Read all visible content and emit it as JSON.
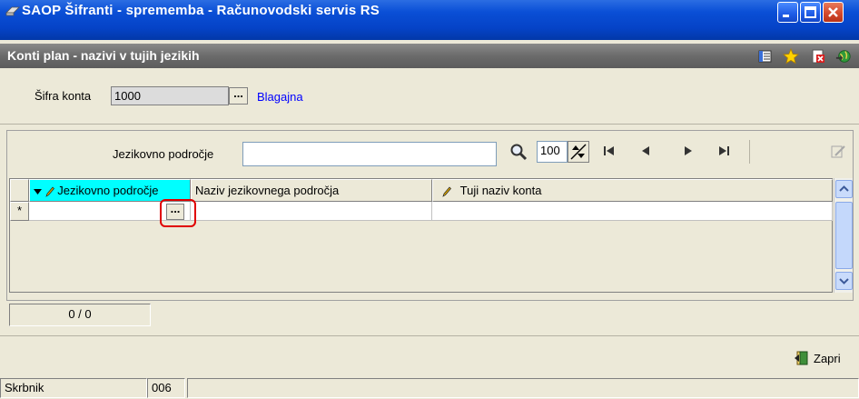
{
  "window": {
    "title": "SAOP  Šifranti - sprememba - Računovodski servis RS",
    "controls": [
      "minimize-icon",
      "maximize-icon",
      "close-icon"
    ]
  },
  "subheader": {
    "title": "Konti plan - nazivi v tujih jezikih",
    "tools": [
      "list-icon",
      "star-icon",
      "delete-icon",
      "globe-icon"
    ]
  },
  "account": {
    "label": "Šifra konta",
    "value": "1000",
    "lookup_label": "...",
    "name": "Blagajna"
  },
  "filter": {
    "label": "Jezikovno področje",
    "value": "",
    "page_size": "100"
  },
  "grid": {
    "columns": [
      "Jezikovno področje",
      "Naziv jezikovnega področja",
      "Tuji naziv konta"
    ],
    "new_row_marker": "*",
    "lookup_label": "..."
  },
  "record_counter": "0 / 0",
  "close_button": {
    "label": "Zapri"
  },
  "status": {
    "role": "Skrbnik",
    "code": "006"
  },
  "colors": {
    "titlebar": "#0543c7",
    "subheader": "#6b6b6b",
    "active_column": "#00ffff",
    "link": "#0000ff",
    "highlight": "#e00000"
  }
}
